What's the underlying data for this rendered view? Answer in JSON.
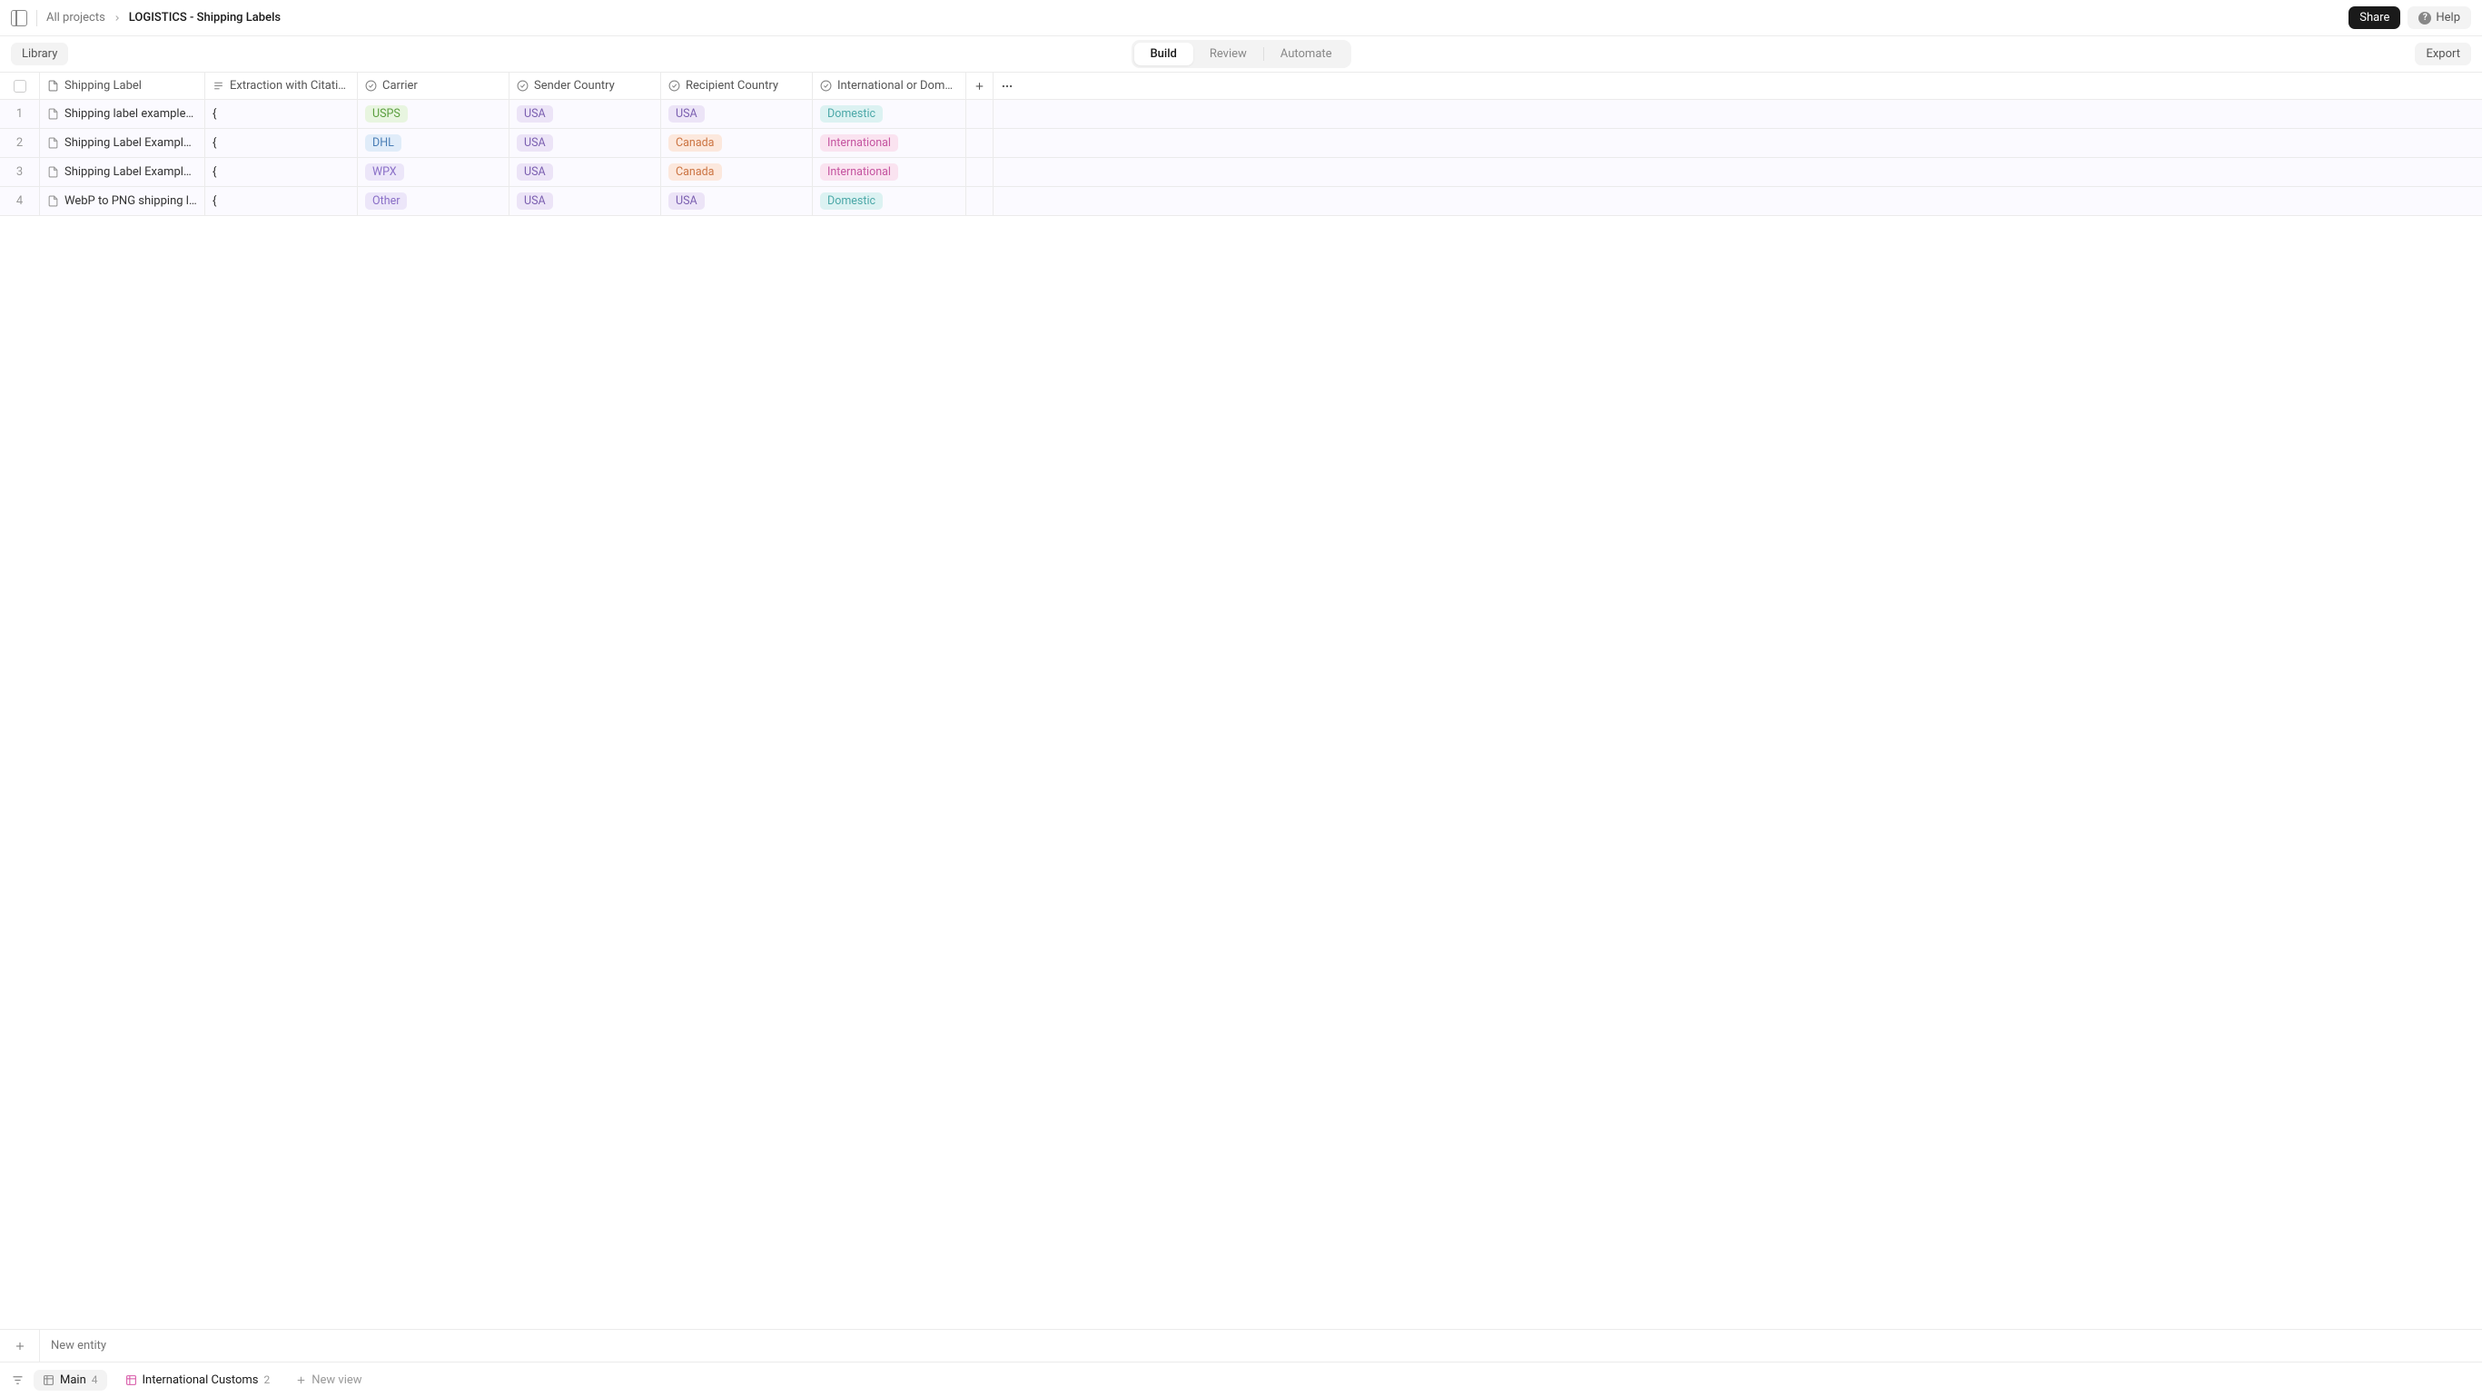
{
  "header": {
    "breadcrumb_root": "All projects",
    "breadcrumb_current": "LOGISTICS - Shipping Labels",
    "share_label": "Share",
    "help_label": "Help"
  },
  "toolbar": {
    "library_label": "Library",
    "tabs": {
      "build": "Build",
      "review": "Review",
      "automate": "Automate"
    },
    "export_label": "Export"
  },
  "columns": {
    "doc": "Shipping Label",
    "extract": "Extraction with Citations",
    "carrier": "Carrier",
    "sender": "Sender Country",
    "recipient": "Recipient Country",
    "intl": "International or Domes..."
  },
  "rows": [
    {
      "num": "1",
      "file": "Shipping label examples....",
      "extract": "{",
      "carrier": {
        "text": "USPS",
        "cls": "tag-green"
      },
      "sender": {
        "text": "USA",
        "cls": "tag-purple"
      },
      "recipient": {
        "text": "USA",
        "cls": "tag-purple"
      },
      "intl": {
        "text": "Domestic",
        "cls": "tag-cyan"
      }
    },
    {
      "num": "2",
      "file": "Shipping Label Example...",
      "extract": "{",
      "carrier": {
        "text": "DHL",
        "cls": "tag-blue"
      },
      "sender": {
        "text": "USA",
        "cls": "tag-purple"
      },
      "recipient": {
        "text": "Canada",
        "cls": "tag-orange"
      },
      "intl": {
        "text": "International",
        "cls": "tag-pink"
      }
    },
    {
      "num": "3",
      "file": "Shipping Label Example...",
      "extract": "{",
      "carrier": {
        "text": "WPX",
        "cls": "tag-lightpurple"
      },
      "sender": {
        "text": "USA",
        "cls": "tag-purple"
      },
      "recipient": {
        "text": "Canada",
        "cls": "tag-orange"
      },
      "intl": {
        "text": "International",
        "cls": "tag-pink"
      }
    },
    {
      "num": "4",
      "file": "WebP to PNG shipping la...",
      "extract": "{",
      "carrier": {
        "text": "Other",
        "cls": "tag-lightpurple"
      },
      "sender": {
        "text": "USA",
        "cls": "tag-purple"
      },
      "recipient": {
        "text": "USA",
        "cls": "tag-purple"
      },
      "intl": {
        "text": "Domestic",
        "cls": "tag-cyan"
      }
    }
  ],
  "footer": {
    "new_entity_placeholder": "New entity",
    "views": {
      "main_label": "Main",
      "main_count": "4",
      "intl_label": "International Customs",
      "intl_count": "2",
      "new_view_label": "New view"
    }
  }
}
